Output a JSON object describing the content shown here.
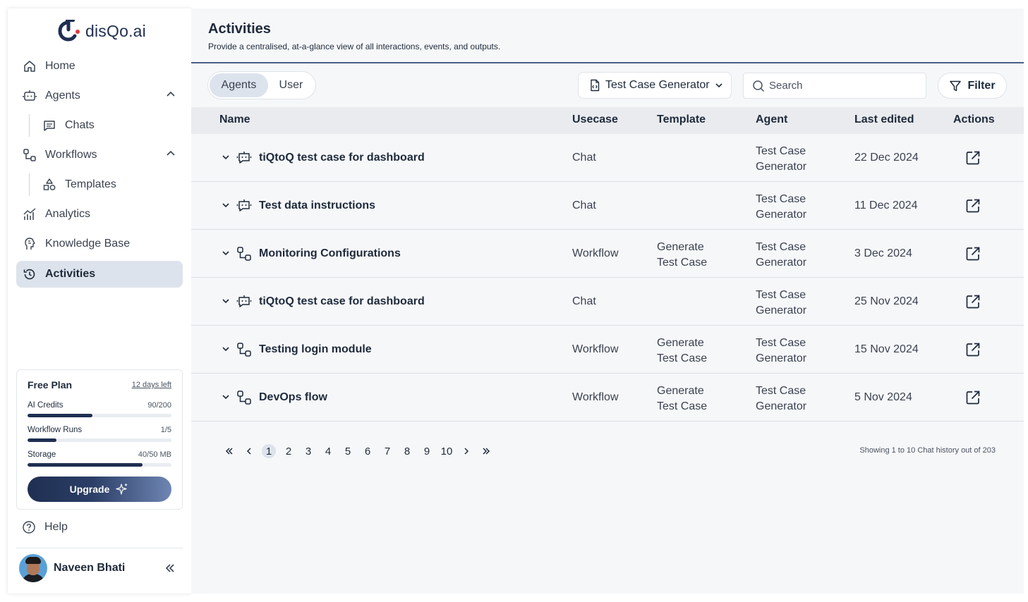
{
  "brand": {
    "name": "disQo.ai"
  },
  "sidebar": {
    "items": [
      {
        "label": "Home",
        "icon": "home-icon"
      },
      {
        "label": "Agents",
        "icon": "bot-icon"
      },
      {
        "label": "Chats",
        "icon": "chat-icon"
      },
      {
        "label": "Workflows",
        "icon": "workflow-icon"
      },
      {
        "label": "Templates",
        "icon": "shapes-icon"
      },
      {
        "label": "Analytics",
        "icon": "analytics-icon"
      },
      {
        "label": "Knowledge Base",
        "icon": "brain-icon"
      },
      {
        "label": "Activities",
        "icon": "history-icon"
      }
    ],
    "active": "Activities",
    "plan": {
      "title": "Free Plan",
      "days_left": "12 days left",
      "meters": [
        {
          "label": "AI Credits",
          "value": "90/200",
          "fraction": 0.45
        },
        {
          "label": "Workflow Runs",
          "value": "1/5",
          "fraction": 0.2
        },
        {
          "label": "Storage",
          "value": "40/50 MB",
          "fraction": 0.8
        }
      ],
      "upgrade_label": "Upgrade"
    },
    "help_label": "Help",
    "user_name": "Naveen Bhati"
  },
  "header": {
    "title": "Activities",
    "subtitle": "Provide a centralised, at-a-glance view of all interactions, events, and outputs."
  },
  "toolbar": {
    "tabs": [
      "Agents",
      "User"
    ],
    "selected_tab": "Agents",
    "agent_select": "Test Case Generator",
    "search_placeholder": "Search",
    "filter_label": "Filter"
  },
  "table": {
    "columns": [
      "Name",
      "Usecase",
      "Template",
      "Agent",
      "Last edited",
      "Actions"
    ],
    "rows": [
      {
        "name": "tiQtoQ test case for dashboard",
        "kind": "chat",
        "usecase": "Chat",
        "template": "",
        "agent": "Test Case Generator",
        "last_edited": "22 Dec 2024"
      },
      {
        "name": "Test data instructions",
        "kind": "chat",
        "usecase": "Chat",
        "template": "",
        "agent": "Test Case Generator",
        "last_edited": "11 Dec 2024"
      },
      {
        "name": "Monitoring Configurations",
        "kind": "workflow",
        "usecase": "Workflow",
        "template": "Generate Test Case",
        "agent": "Test Case Generator",
        "last_edited": "3 Dec 2024"
      },
      {
        "name": "tiQtoQ test case for dashboard",
        "kind": "chat",
        "usecase": "Chat",
        "template": "",
        "agent": "Test Case Generator",
        "last_edited": "25 Nov 2024"
      },
      {
        "name": "Testing login module",
        "kind": "workflow",
        "usecase": "Workflow",
        "template": "Generate Test Case",
        "agent": "Test Case Generator",
        "last_edited": "15 Nov 2024"
      },
      {
        "name": "DevOps flow",
        "kind": "workflow",
        "usecase": "Workflow",
        "template": "Generate Test Case",
        "agent": "Test Case Generator",
        "last_edited": "5 Nov 2024"
      }
    ]
  },
  "pagination": {
    "pages": [
      "1",
      "2",
      "3",
      "4",
      "5",
      "6",
      "7",
      "8",
      "9",
      "10"
    ],
    "current": "1",
    "summary": "Showing 1 to 10 Chat history out of 203"
  },
  "colors": {
    "primary": "#1f2f52",
    "active_bg": "#dde3ec",
    "header_rule": "#4a5f86"
  }
}
